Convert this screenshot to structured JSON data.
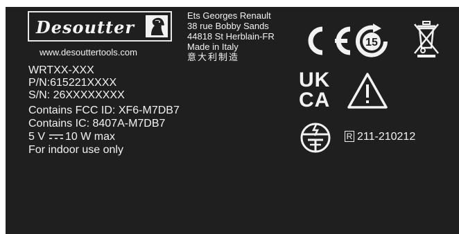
{
  "brand": {
    "logo_text": "Desoutter",
    "website": "www.desouttertools.com"
  },
  "manufacturer": {
    "lines": [
      "Ets Georges Renault",
      "38 rue Bobby Sands",
      "44818 St Herblain-FR",
      "Made in Italy",
      "意大利制造"
    ]
  },
  "product": {
    "model": "WRTXX-XXX",
    "part_number": "P/N:615221XXXX",
    "serial_number": "S/N: 26XXXXXXXX",
    "fcc": "Contains FCC ID: XF6-M7DB7",
    "ic": "Contains IC: 8407A-M7DB7",
    "power_voltage": "5 V",
    "power_rating": "10 W max",
    "usage_note": "For indoor use only"
  },
  "marks": {
    "ukca_top": "UK",
    "ukca_bottom": "CA",
    "china_rohs_number": "15",
    "japan_radio_r": "R",
    "japan_radio_number": "211-210212"
  },
  "colors": {
    "label_background": "#1f1f1f",
    "print": "#f2f2f2"
  },
  "icons": [
    "horse-logo-icon",
    "ce-mark-icon",
    "china-rohs-15-icon",
    "crossed-bin-weee-icon",
    "ukca-mark-icon",
    "warning-triangle-icon",
    "japan-giteki-icon",
    "dc-symbol-icon"
  ]
}
